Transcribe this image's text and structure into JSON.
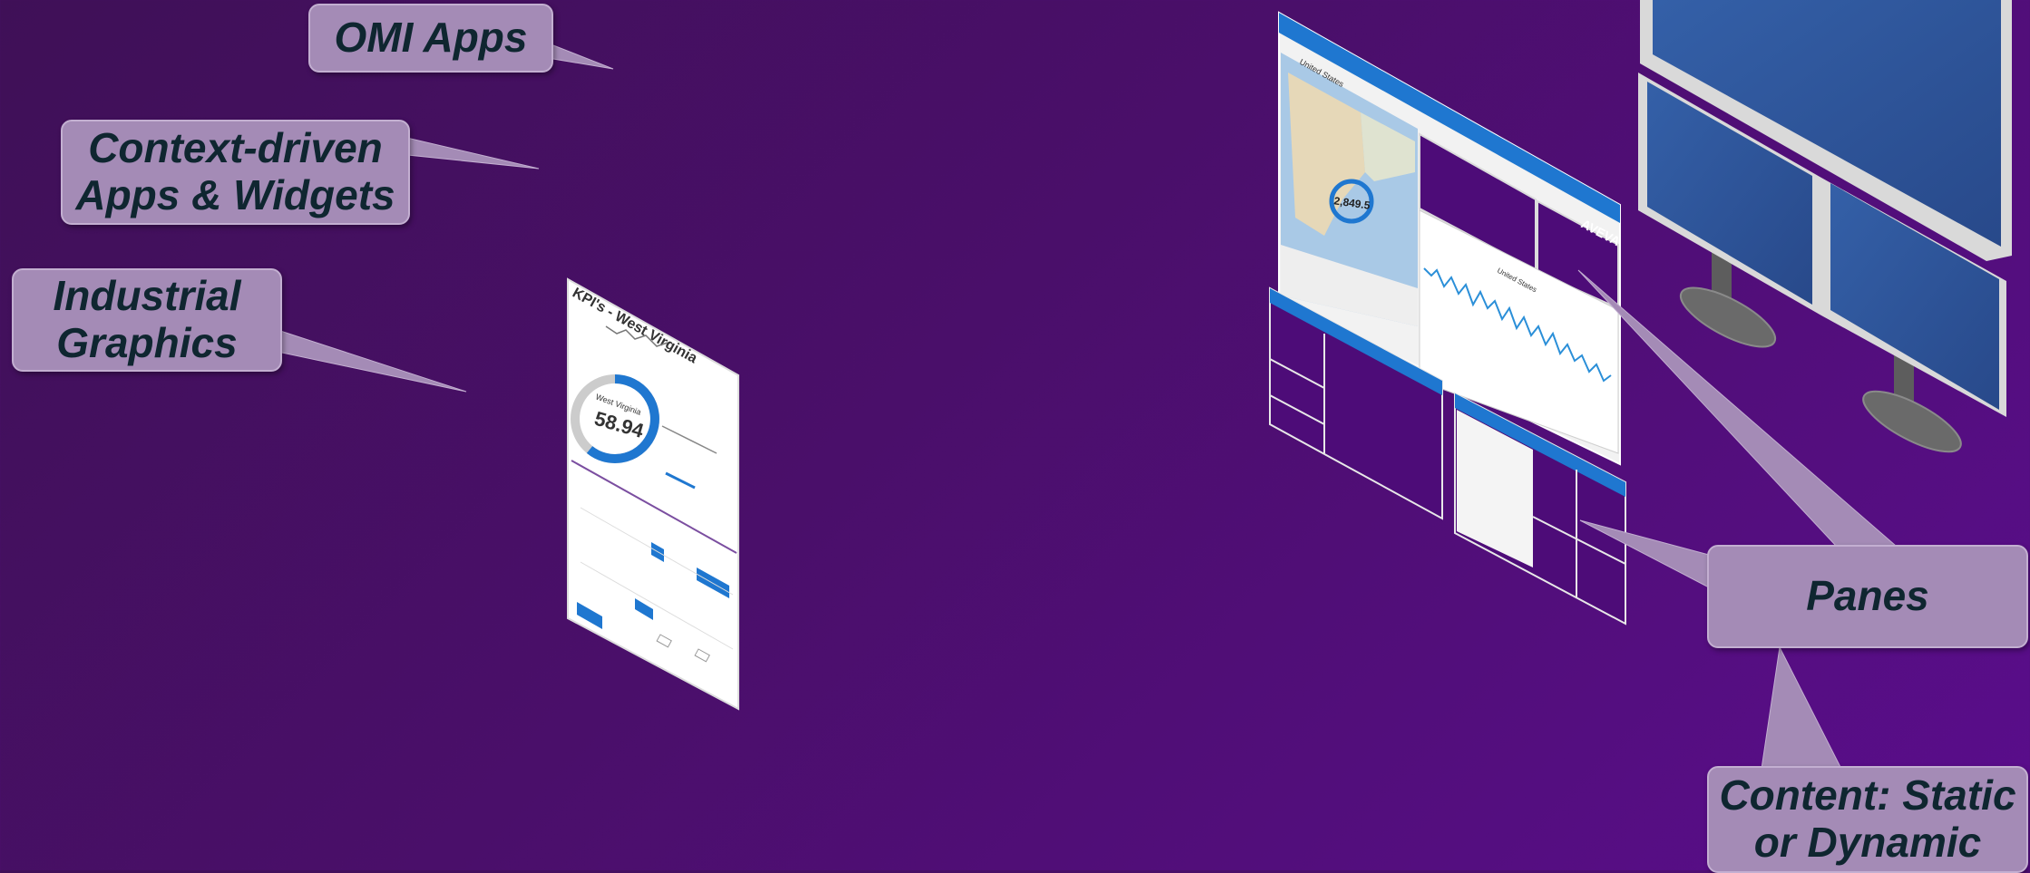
{
  "callouts": {
    "omi_apps": "OMI Apps",
    "context_line1": "Context-driven",
    "context_line2": "Apps & Widgets",
    "industrial_line1": "Industrial",
    "industrial_line2": "Graphics",
    "panes": "Panes",
    "content_line1": "Content: Static",
    "content_line2": "or Dynamic"
  },
  "kpi_panel": {
    "title": "KPI's - West Virginia",
    "gauge_label": "West Virginia",
    "gauge_value": "58.94"
  },
  "map_panel": {
    "breadcrumb": "United States",
    "map_value": "2,849.5",
    "chart_title": "United States",
    "brand": "AVEVA"
  },
  "colors": {
    "background_start": "#3f1057",
    "background_end": "#5a0d8c",
    "callout_fill": "#a48bb6",
    "callout_text": "#0f2630",
    "ui_accent": "#1f77d0",
    "monitor_blue": "#2e5599"
  }
}
